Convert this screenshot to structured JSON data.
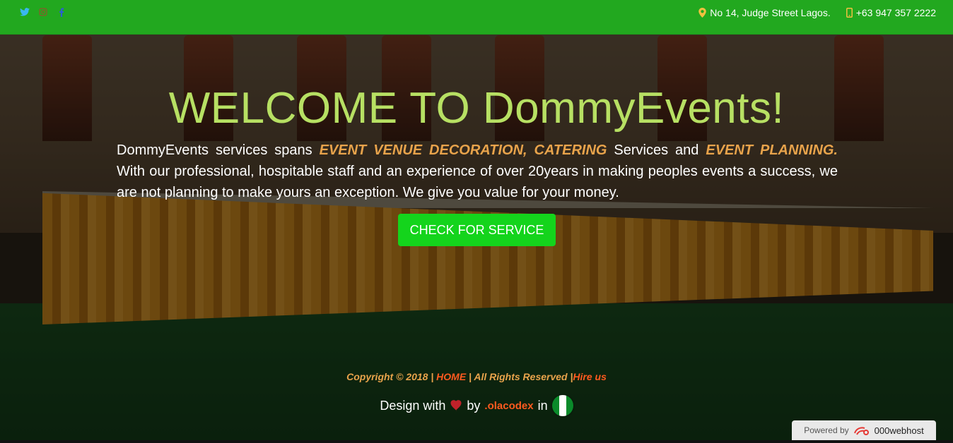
{
  "header": {
    "social_icons": [
      "twitter-icon",
      "instagram-icon",
      "facebook-icon"
    ],
    "address": "No 14, Judge Street Lagos.",
    "phone": "+63 947 357 2222"
  },
  "hero": {
    "title": "WELCOME TO DommyEvents!",
    "desc_part1": "DommyEvents services spans ",
    "highlight1": "EVENT VENUE DECORATION, CATERING",
    "desc_part2": " Services and ",
    "highlight2": "EVENT PLANNING.",
    "desc_part3": " With our professional, hospitable staff and an experience of over 20years in making peoples events a success, we are not planning to make yours an exception. We give you value for your money.",
    "cta_label": "CHECK FOR SERVICE"
  },
  "footer": {
    "copyright_prefix": "Copyright © 2018 | ",
    "home_link": "HOME",
    "rights_text": " | All Rights Reserved |",
    "hire_link": "Hire us",
    "design_prefix": "Design with",
    "design_by": "by",
    "brand": ".olacodex",
    "design_in": "in"
  },
  "powered": {
    "label": "Powered by",
    "host": "000webhost"
  },
  "colors": {
    "topbar": "#22a81f",
    "title": "#b7e063",
    "highlight": "#e8a34b",
    "cta": "#14d41c",
    "link": "#ff5a1f"
  }
}
